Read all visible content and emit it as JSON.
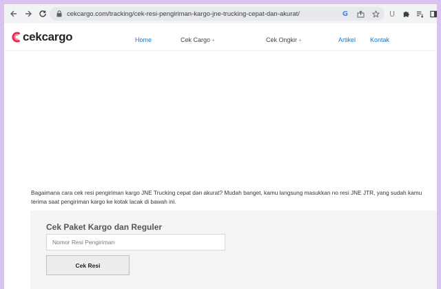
{
  "browser": {
    "url": "cekcargo.com/tracking/cek-resi-pengiriman-kargo-jne-trucking-cepat-dan-akurat/",
    "icons": [
      "back-icon",
      "forward-icon",
      "reload-icon",
      "lock-icon",
      "google-icon",
      "share-icon",
      "star-icon",
      "extension-u-icon",
      "puzzle-icon",
      "reading-list-icon",
      "sidebar-icon"
    ]
  },
  "site": {
    "logo_text": "cekcargo",
    "brand_color": "#e8284a",
    "nav": {
      "home": "Home",
      "cek_cargo": "Cek Cargo",
      "cek_ongkir": "Cek Ongkir",
      "artikel": "Artikel",
      "kontak": "Kontak",
      "caret": "+"
    }
  },
  "content": {
    "intro": "Bagaimana cara cek resi pengiriman kargo JNE Trucking cepat dan akurat? Mudah banget, kamu langsung masukkan no resi JNE JTR, yang sudah kamu terima saat pengiriman kargo ke kotak lacak di bawah ini."
  },
  "tracking_form": {
    "title": "Cek Paket Kargo dan Reguler",
    "input_value": "",
    "input_placeholder": "Nomor Resi Pengiriman",
    "submit_label": "Cek Resi"
  }
}
